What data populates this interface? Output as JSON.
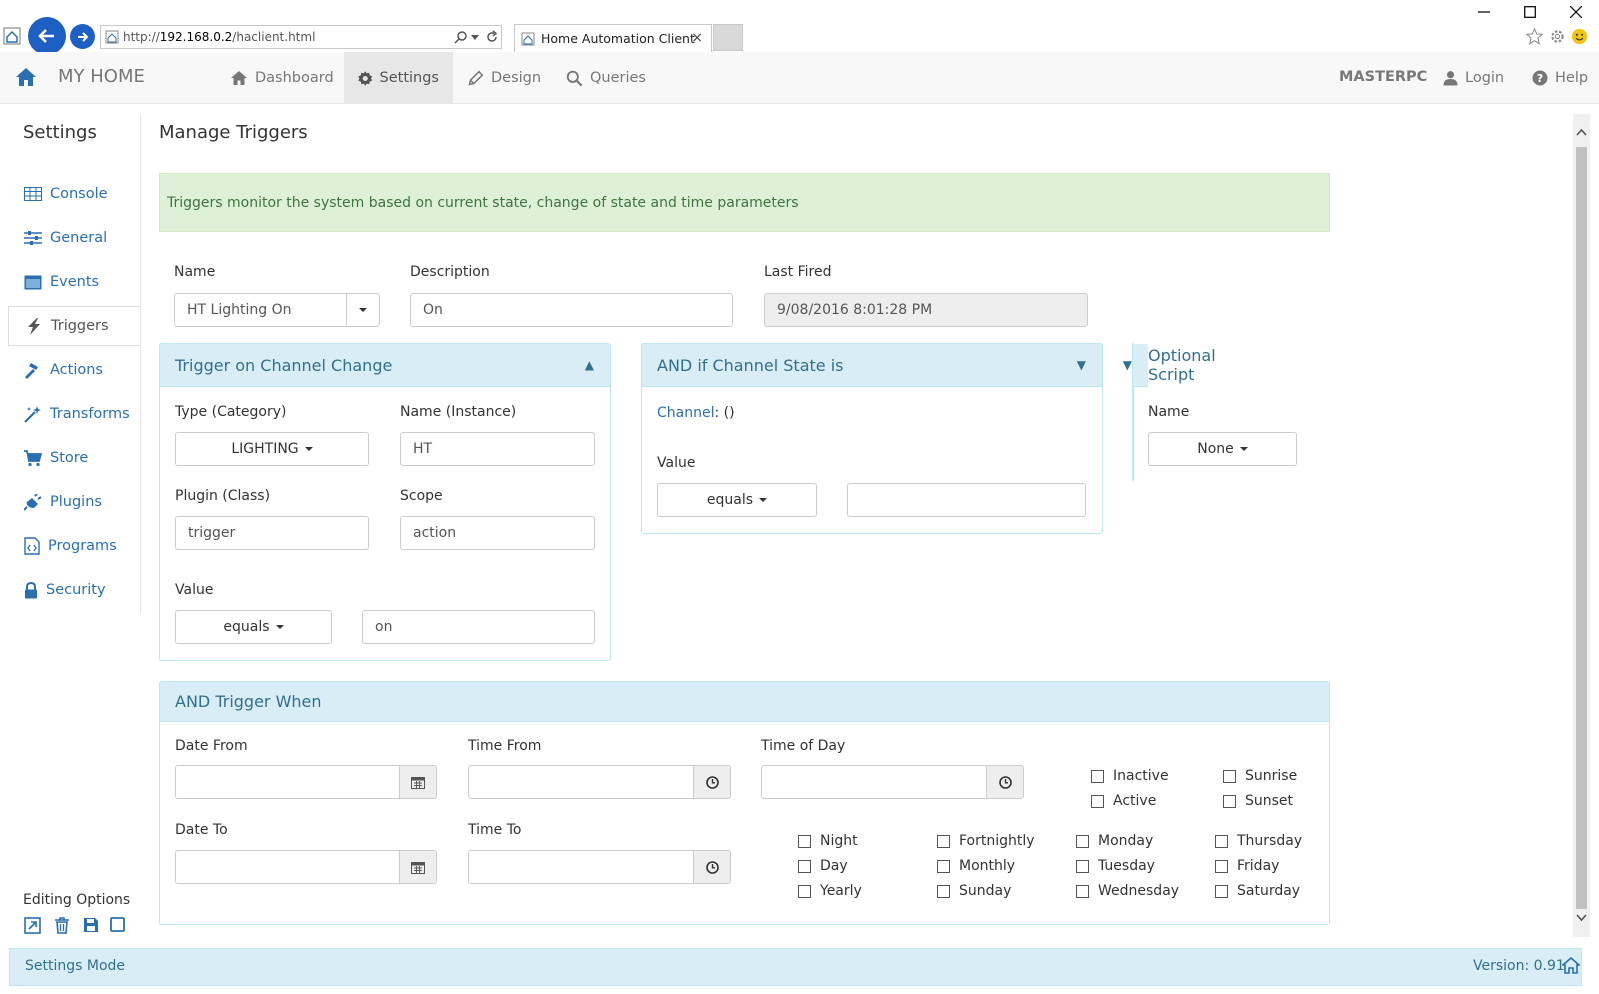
{
  "browser": {
    "url_prefix": "http://",
    "url_host": "192.168.0.2",
    "url_path": "/haclient.html",
    "tab_title": "Home Automation Client",
    "tab_close": "×"
  },
  "navbar": {
    "brand": "MY HOME",
    "items": [
      {
        "label": "Dashboard",
        "icon": "home-icon"
      },
      {
        "label": "Settings",
        "icon": "gear-icon",
        "active": true
      },
      {
        "label": "Design",
        "icon": "pencil-icon"
      },
      {
        "label": "Queries",
        "icon": "search-icon"
      }
    ],
    "machine": "MASTERPC",
    "login": "Login",
    "help": "Help"
  },
  "sidebar": {
    "title": "Settings",
    "items": [
      {
        "label": "Console",
        "icon": "table-icon"
      },
      {
        "label": "General",
        "icon": "sliders-icon"
      },
      {
        "label": "Events",
        "icon": "window-icon"
      },
      {
        "label": "Triggers",
        "icon": "lightning-icon",
        "active": true
      },
      {
        "label": "Actions",
        "icon": "hammer-icon"
      },
      {
        "label": "Transforms",
        "icon": "wand-icon"
      },
      {
        "label": "Store",
        "icon": "cart-icon"
      },
      {
        "label": "Plugins",
        "icon": "plug-icon"
      },
      {
        "label": "Programs",
        "icon": "code-file-icon"
      },
      {
        "label": "Security",
        "icon": "lock-icon"
      }
    ],
    "editing_title": "Editing Options"
  },
  "main": {
    "title": "Manage Triggers",
    "alert": "Triggers monitor the system based on current state, change of state and time parameters",
    "name_label": "Name",
    "name_value": "HT Lighting On",
    "description_label": "Description",
    "description_value": "On",
    "last_fired_label": "Last Fired",
    "last_fired_value": "9/08/2016 8:01:28 PM"
  },
  "trigger_panel": {
    "title": "Trigger on Channel Change",
    "arrow": "▲",
    "type_label": "Type (Category)",
    "type_value": "LIGHTING",
    "name_label": "Name (Instance)",
    "name_value": "HT",
    "plugin_label": "Plugin (Class)",
    "plugin_value": "trigger",
    "scope_label": "Scope",
    "scope_value": "action",
    "value_label": "Value",
    "operator": "equals",
    "value": "on"
  },
  "state_panel": {
    "title": "AND if Channel State is",
    "arrow": "▼",
    "channel_label": "Channel",
    "channel_value": ": ()",
    "value_label": "Value",
    "operator": "equals",
    "value": ""
  },
  "script_panel": {
    "title": "Optional Script",
    "arrow": "▼",
    "name_label": "Name",
    "name_value": "None"
  },
  "when_panel": {
    "title": "AND Trigger When",
    "date_from_label": "Date From",
    "time_from_label": "Time From",
    "time_of_day_label": "Time of Day",
    "date_to_label": "Date To",
    "time_to_label": "Time To",
    "checks": {
      "inactive": "Inactive",
      "sunrise": "Sunrise",
      "active": "Active",
      "sunset": "Sunset",
      "night": "Night",
      "fortnightly": "Fortnightly",
      "monday": "Monday",
      "thursday": "Thursday",
      "day": "Day",
      "monthly": "Monthly",
      "tuesday": "Tuesday",
      "friday": "Friday",
      "yearly": "Yearly",
      "sunday": "Sunday",
      "wednesday": "Wednesday",
      "saturday": "Saturday"
    }
  },
  "footer": {
    "mode": "Settings Mode",
    "version": "Version: 0.91"
  },
  "colors": {
    "link": "#2a6fb0",
    "panel_header": "#d9edf7",
    "panel_border": "#bce8f1",
    "alert_bg": "#dff0d8",
    "alert_text": "#3c763d",
    "browser_blue": "#1e5fc4"
  }
}
